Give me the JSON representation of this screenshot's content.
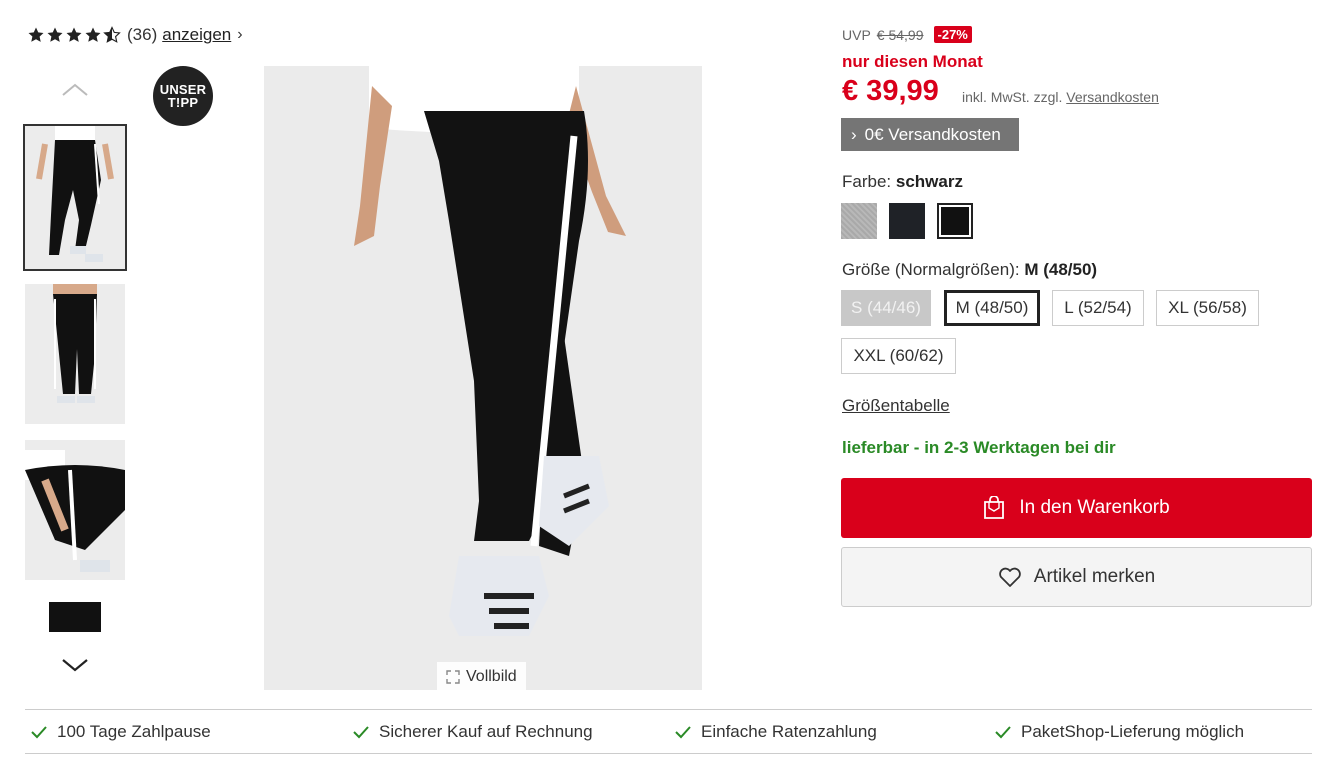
{
  "rating": {
    "stars": 4.5,
    "count": "(36)",
    "link_label": "anzeigen"
  },
  "badge": {
    "line1": "UNSER",
    "line2": "T!PP"
  },
  "gallery": {
    "fullscreen_label": "Vollbild",
    "thumbnail_count_visible": 4,
    "active_index": 0
  },
  "price": {
    "uvp_label": "UVP",
    "old_price": "€ 54,99",
    "discount": "-27%",
    "promo": "nur diesen Monat",
    "current": "€ 39,99",
    "vat_text": "inkl. MwSt. zzgl.",
    "shipping_link": "Versandkosten",
    "free_shipping": "0€ Versandkosten"
  },
  "color": {
    "label": "Farbe:",
    "selected": "schwarz",
    "options": [
      "grau",
      "dunkelblau",
      "schwarz"
    ]
  },
  "size": {
    "label": "Größe (Normalgrößen):",
    "selected": "M (48/50)",
    "options": [
      "S (44/46)",
      "M (48/50)",
      "L (52/54)",
      "XL (56/58)",
      "XXL (60/62)"
    ]
  },
  "size_table_label": "Größentabelle",
  "availability": "lieferbar - in 2-3 Werktagen bei dir",
  "buttons": {
    "cart": "In den Warenkorb",
    "wishlist": "Artikel merken"
  },
  "benefits": [
    "100 Tage Zahlpause",
    "Sicherer Kauf auf Rechnung",
    "Einfache Ratenzahlung",
    "PaketShop-Lieferung möglich"
  ],
  "colors": {
    "accent_red": "#d9001b",
    "availability_green": "#2a8a26",
    "shipping_badge_gray": "#757575"
  }
}
